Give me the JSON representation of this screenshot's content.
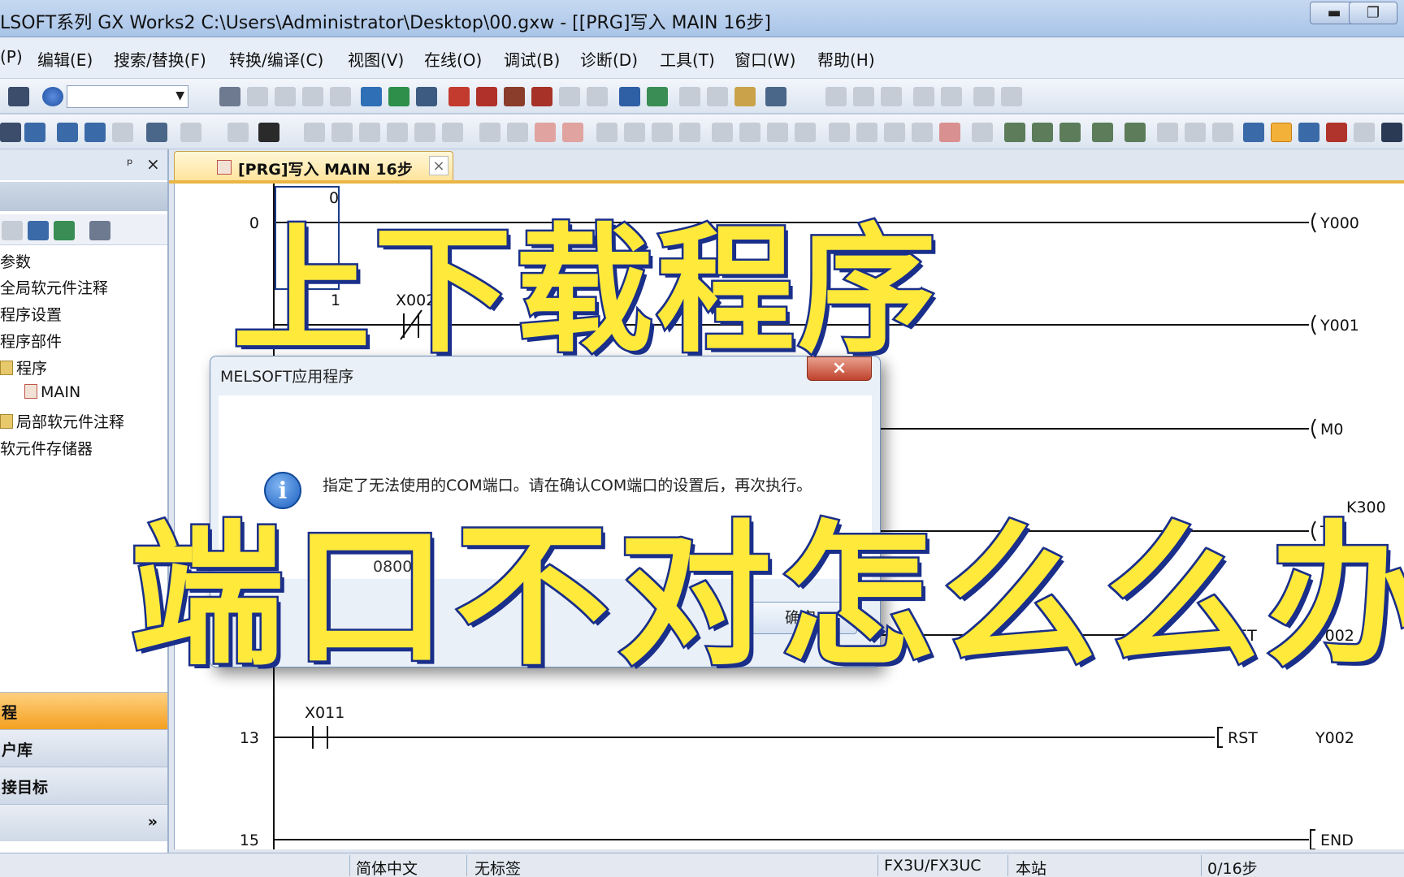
{
  "window": {
    "title": "LSOFT系列 GX Works2 C:\\Users\\Administrator\\Desktop\\00.gxw - [[PRG]写入 MAIN 16步]",
    "minimize": "▬",
    "maximize": "❐"
  },
  "menu": [
    "(P)",
    "编辑(E)",
    "搜索/替换(F)",
    "转换/编译(C)",
    "视图(V)",
    "在线(O)",
    "调试(B)",
    "诊断(D)",
    "工具(T)",
    "窗口(W)",
    "帮助(H)"
  ],
  "left_panel": {
    "pin": "ᵖ",
    "close": "×",
    "tree": [
      "参数",
      "全局软元件注释",
      "程序设置",
      "程序部件",
      "程序",
      "MAIN",
      "局部软元件注释",
      "软元件存储器"
    ],
    "nav": [
      "程",
      "户库",
      "接目标"
    ],
    "more": "»"
  },
  "tab": {
    "label": "[PRG]写入 MAIN 16步",
    "close": "×"
  },
  "ladder": {
    "step_numbers": [
      "0",
      "",
      "",
      "",
      "",
      "13",
      "15"
    ],
    "contacts": [
      {
        "label": "X002",
        "type": "nc"
      },
      {
        "label": "X011",
        "type": "no"
      }
    ],
    "coils": [
      "Y000",
      "Y001",
      "M0",
      "T0",
      "SET",
      "RST",
      "END"
    ],
    "coil_operands": [
      "K300",
      "Y002",
      "Y002"
    ],
    "partial_labels": [
      "0",
      "1"
    ]
  },
  "dialog": {
    "title": "MELSOFT应用程序",
    "close": "×",
    "message": "指定了无法使用的COM端口。请在确认COM端口的设置后，再次执行。",
    "code": "0800",
    "ok": "确定"
  },
  "captions": {
    "line1": "上下载程序",
    "line2": "端口不对怎么么办"
  },
  "status": {
    "lang": "简体中文",
    "label": "无标签",
    "cpu": "FX3U/FX3UC",
    "station": "本站",
    "steps": "0/16步"
  },
  "toolbar": {
    "combo_value": ""
  }
}
